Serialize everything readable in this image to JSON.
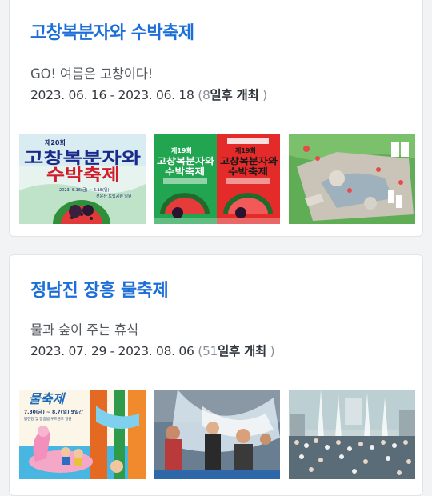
{
  "festivals": [
    {
      "title": "고창복분자와 수박축제",
      "subtitle": "GO! 여름은 고창이다!",
      "date_range": "2023. 06. 16 - 2023. 06. 18",
      "paren_open": "(",
      "days": "8",
      "days_suffix": "일후 개최",
      "paren_close": ")",
      "images": [
        {
          "icon": "festival-poster",
          "text_line1": "제20회",
          "text_line2": "고창복분자와",
          "text_line3": "수박축제",
          "text_line4": "2023. 6.16(금) ~ 6.18(일)",
          "text_line5": "선운산 도립공원 일원"
        },
        {
          "icon": "festival-poster-pair",
          "poster_a_line1": "제19회",
          "poster_a_line2": "고창복분자와",
          "poster_a_line3": "수박축제",
          "poster_b_line1": "제19회",
          "poster_b_line2": "고창복분자와",
          "poster_b_line3": "수박축제"
        },
        {
          "icon": "festival-map"
        }
      ]
    },
    {
      "title": "정남진 장흥 물축제",
      "subtitle": "물과 숲이 주는 휴식",
      "date_range": "2023. 07. 29 - 2023. 08. 06",
      "paren_open": "(",
      "days": "51",
      "days_suffix": "일후 개최",
      "paren_close": ")",
      "images": [
        {
          "icon": "festival-poster",
          "text_line1": "물축제",
          "text_line2": "7.30(금) ~ 8.7(일) 9일간",
          "text_line3": "탐진강 및 장흥댐 우드랜드 일원"
        },
        {
          "icon": "water-splash-photo"
        },
        {
          "icon": "crowd-photo"
        }
      ]
    }
  ]
}
